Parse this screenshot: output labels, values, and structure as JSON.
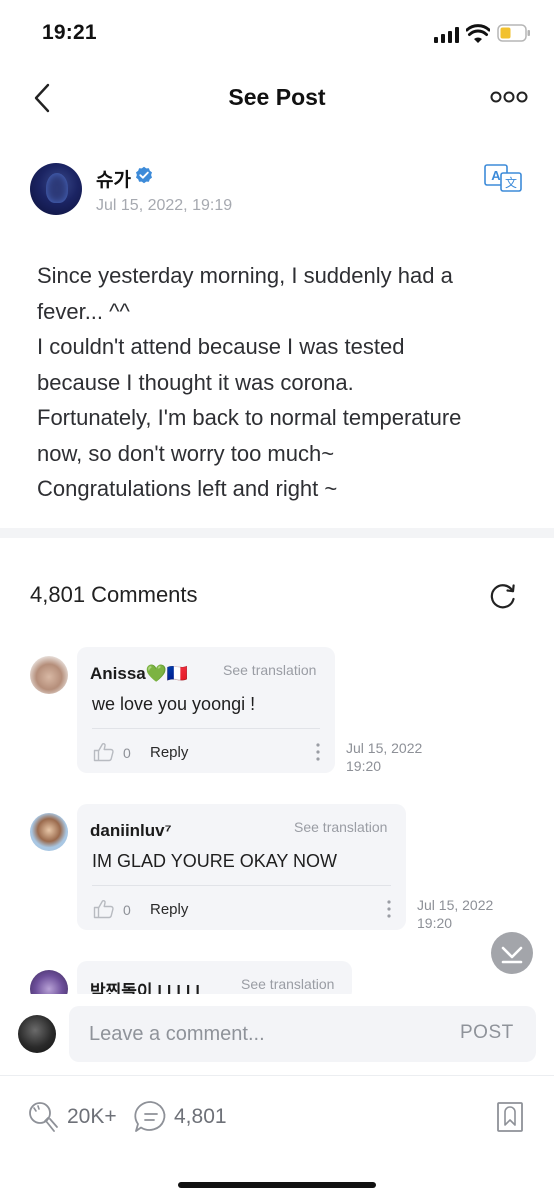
{
  "status_bar": {
    "time": "19:21"
  },
  "nav": {
    "title": "See Post"
  },
  "post": {
    "author": "슈가",
    "date": "Jul 15, 2022, 19:19",
    "lines": [
      "Since yesterday morning, I suddenly had a",
      "fever... ^^",
      "I couldn't attend because I was tested",
      "because I thought it was corona.",
      "Fortunately, I'm back to normal temperature",
      "now, so don't worry too much~",
      "Congratulations left and right ~"
    ]
  },
  "comments_header": {
    "count_label": "4,801 Comments"
  },
  "comments": [
    {
      "name": "Anissa💚🇫🇷",
      "translate_label": "See translation",
      "text": "we love you yoongi !",
      "likes": "0",
      "reply_label": "Reply",
      "date_line1": "Jul 15, 2022",
      "date_line2": "19:20"
    },
    {
      "name": "daniinluv⁷",
      "translate_label": "See translation",
      "text": "IM GLAD YOURE OKAY NOW",
      "likes": "0",
      "reply_label": "Reply",
      "date_line1": "Jul 15, 2022",
      "date_line2": "19:20"
    },
    {
      "name": "박찐돌이 | | | | |",
      "translate_label": "See translation"
    }
  ],
  "comment_input": {
    "placeholder": "Leave a comment...",
    "post_label": "POST"
  },
  "bottom_bar": {
    "likes": "20K+",
    "comments": "4,801"
  },
  "colors": {
    "accent_blue": "#3d8bd9",
    "verified": "#3d8bd9",
    "bubble_bg": "#f4f5f8"
  }
}
